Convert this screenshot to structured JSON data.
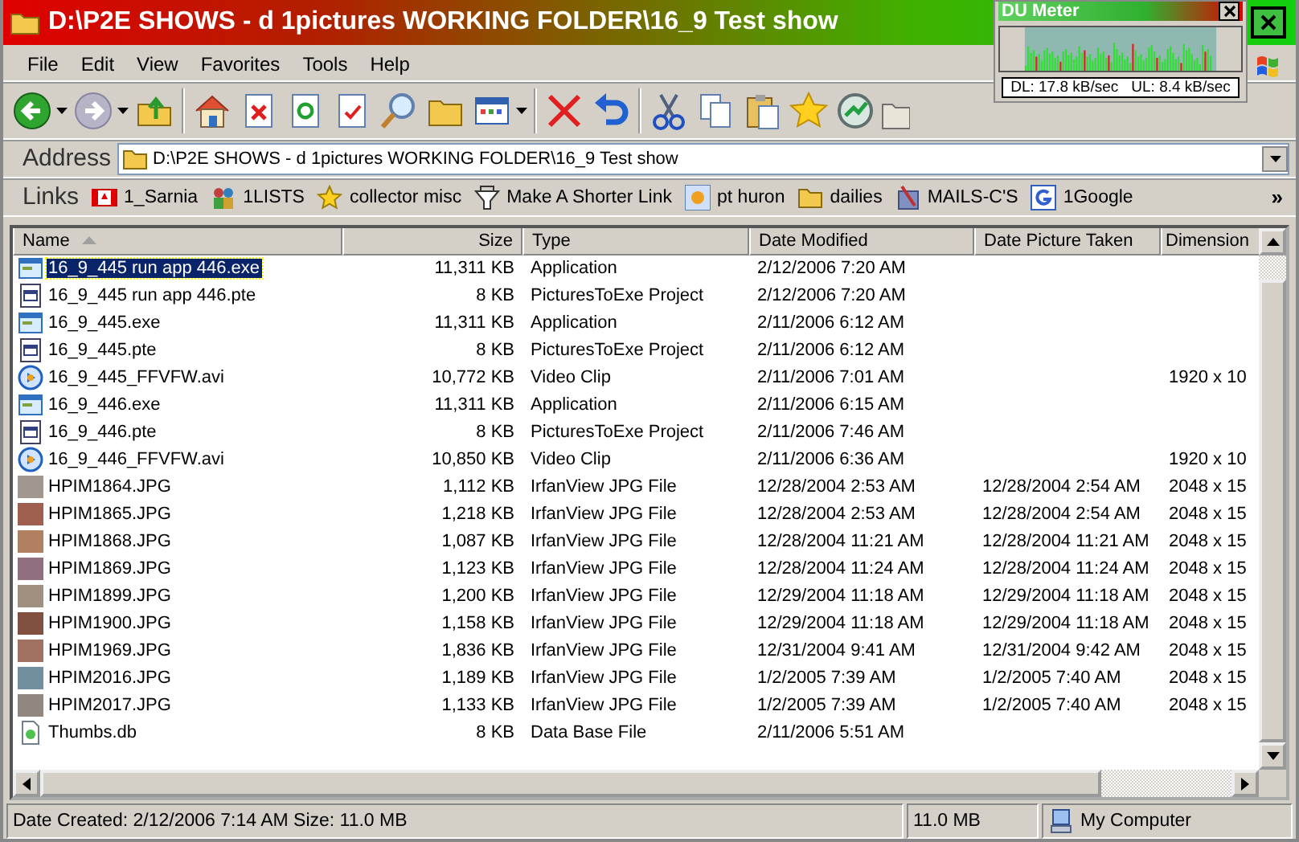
{
  "window": {
    "title": "D:\\P2E SHOWS - d 1pictures WORKING FOLDER\\16_9 Test show"
  },
  "du_meter": {
    "title": "DU Meter",
    "download": "DL: 17.8 kB/sec",
    "upload": "UL: 8.4 kB/sec"
  },
  "menu": [
    "File",
    "Edit",
    "View",
    "Favorites",
    "Tools",
    "Help"
  ],
  "address": {
    "label": "Address",
    "path": "D:\\P2E SHOWS - d 1pictures WORKING FOLDER\\16_9 Test show"
  },
  "links": {
    "label": "Links",
    "overflow": "»",
    "items": [
      {
        "label": "1_Sarnia",
        "kind": "flag"
      },
      {
        "label": "1LISTS",
        "kind": "people"
      },
      {
        "label": "collector misc",
        "kind": "star"
      },
      {
        "label": "Make A Shorter Link",
        "kind": "tray"
      },
      {
        "label": "pt huron",
        "kind": "sun"
      },
      {
        "label": "dailies",
        "kind": "folder"
      },
      {
        "label": "MAILS-C'S",
        "kind": "tools"
      },
      {
        "label": "1Google",
        "kind": "g"
      }
    ]
  },
  "table": {
    "columns": [
      {
        "label": "Name",
        "sorted": true
      },
      {
        "label": "Size"
      },
      {
        "label": "Type"
      },
      {
        "label": "Date Modified"
      },
      {
        "label": "Date Picture Taken"
      },
      {
        "label": "Dimension"
      }
    ],
    "rows": [
      {
        "kind": "exe",
        "selected": true,
        "name": "16_9_445 run app 446.exe",
        "size": "11,311 KB",
        "type": "Application",
        "modified": "2/12/2006 7:20 AM"
      },
      {
        "kind": "pte",
        "selected": false,
        "name": "16_9_445 run app 446.pte",
        "size": "8 KB",
        "type": "PicturesToExe Project",
        "modified": "2/12/2006 7:20 AM"
      },
      {
        "kind": "exe",
        "selected": false,
        "name": "16_9_445.exe",
        "size": "11,311 KB",
        "type": "Application",
        "modified": "2/11/2006 6:12 AM"
      },
      {
        "kind": "pte",
        "selected": false,
        "name": "16_9_445.pte",
        "size": "8 KB",
        "type": "PicturesToExe Project",
        "modified": "2/11/2006 6:12 AM"
      },
      {
        "kind": "avi",
        "selected": false,
        "name": "16_9_445_FFVFW.avi",
        "size": "10,772 KB",
        "type": "Video Clip",
        "modified": "2/11/2006 7:01 AM",
        "dimensions": "1920 x 10"
      },
      {
        "kind": "exe",
        "selected": false,
        "name": "16_9_446.exe",
        "size": "11,311 KB",
        "type": "Application",
        "modified": "2/11/2006 6:15 AM"
      },
      {
        "kind": "pte",
        "selected": false,
        "name": "16_9_446.pte",
        "size": "8 KB",
        "type": "PicturesToExe Project",
        "modified": "2/11/2006 7:46 AM"
      },
      {
        "kind": "avi",
        "selected": false,
        "name": "16_9_446_FFVFW.avi",
        "size": "10,850 KB",
        "type": "Video Clip",
        "modified": "2/11/2006 6:36 AM",
        "dimensions": "1920 x 10"
      },
      {
        "kind": "jpg",
        "selected": false,
        "name": "HPIM1864.JPG",
        "size": "1,112 KB",
        "type": "IrfanView JPG File",
        "modified": "12/28/2004 2:53 AM",
        "taken": "12/28/2004 2:54 AM",
        "dimensions": "2048 x 15"
      },
      {
        "kind": "jpg",
        "selected": false,
        "name": "HPIM1865.JPG",
        "size": "1,218 KB",
        "type": "IrfanView JPG File",
        "modified": "12/28/2004 2:53 AM",
        "taken": "12/28/2004 2:54 AM",
        "dimensions": "2048 x 15"
      },
      {
        "kind": "jpg",
        "selected": false,
        "name": "HPIM1868.JPG",
        "size": "1,087 KB",
        "type": "IrfanView JPG File",
        "modified": "12/28/2004 11:21 AM",
        "taken": "12/28/2004 11:21 AM",
        "dimensions": "2048 x 15"
      },
      {
        "kind": "jpg",
        "selected": false,
        "name": "HPIM1869.JPG",
        "size": "1,123 KB",
        "type": "IrfanView JPG File",
        "modified": "12/28/2004 11:24 AM",
        "taken": "12/28/2004 11:24 AM",
        "dimensions": "2048 x 15"
      },
      {
        "kind": "jpg",
        "selected": false,
        "name": "HPIM1899.JPG",
        "size": "1,200 KB",
        "type": "IrfanView JPG File",
        "modified": "12/29/2004 11:18 AM",
        "taken": "12/29/2004 11:18 AM",
        "dimensions": "2048 x 15"
      },
      {
        "kind": "jpg",
        "selected": false,
        "name": "HPIM1900.JPG",
        "size": "1,158 KB",
        "type": "IrfanView JPG File",
        "modified": "12/29/2004 11:18 AM",
        "taken": "12/29/2004 11:18 AM",
        "dimensions": "2048 x 15"
      },
      {
        "kind": "jpg",
        "selected": false,
        "name": "HPIM1969.JPG",
        "size": "1,836 KB",
        "type": "IrfanView JPG File",
        "modified": "12/31/2004 9:41 AM",
        "taken": "12/31/2004 9:42 AM",
        "dimensions": "2048 x 15"
      },
      {
        "kind": "jpg",
        "selected": false,
        "name": "HPIM2016.JPG",
        "size": "1,189 KB",
        "type": "IrfanView JPG File",
        "modified": "1/2/2005 7:39 AM",
        "taken": "1/2/2005 7:40 AM",
        "dimensions": "2048 x 15"
      },
      {
        "kind": "jpg",
        "selected": false,
        "name": "HPIM2017.JPG",
        "size": "1,133 KB",
        "type": "IrfanView JPG File",
        "modified": "1/2/2005 7:39 AM",
        "taken": "1/2/2005 7:40 AM",
        "dimensions": "2048 x 15"
      },
      {
        "kind": "db",
        "selected": false,
        "name": "Thumbs.db",
        "size": "8 KB",
        "type": "Data Base File",
        "modified": "2/11/2006 5:51 AM"
      }
    ]
  },
  "status_bar": {
    "details": "Date Created: 2/12/2006 7:14 AM Size: 11.0 MB",
    "size": "11.0 MB",
    "zone": "My Computer"
  }
}
